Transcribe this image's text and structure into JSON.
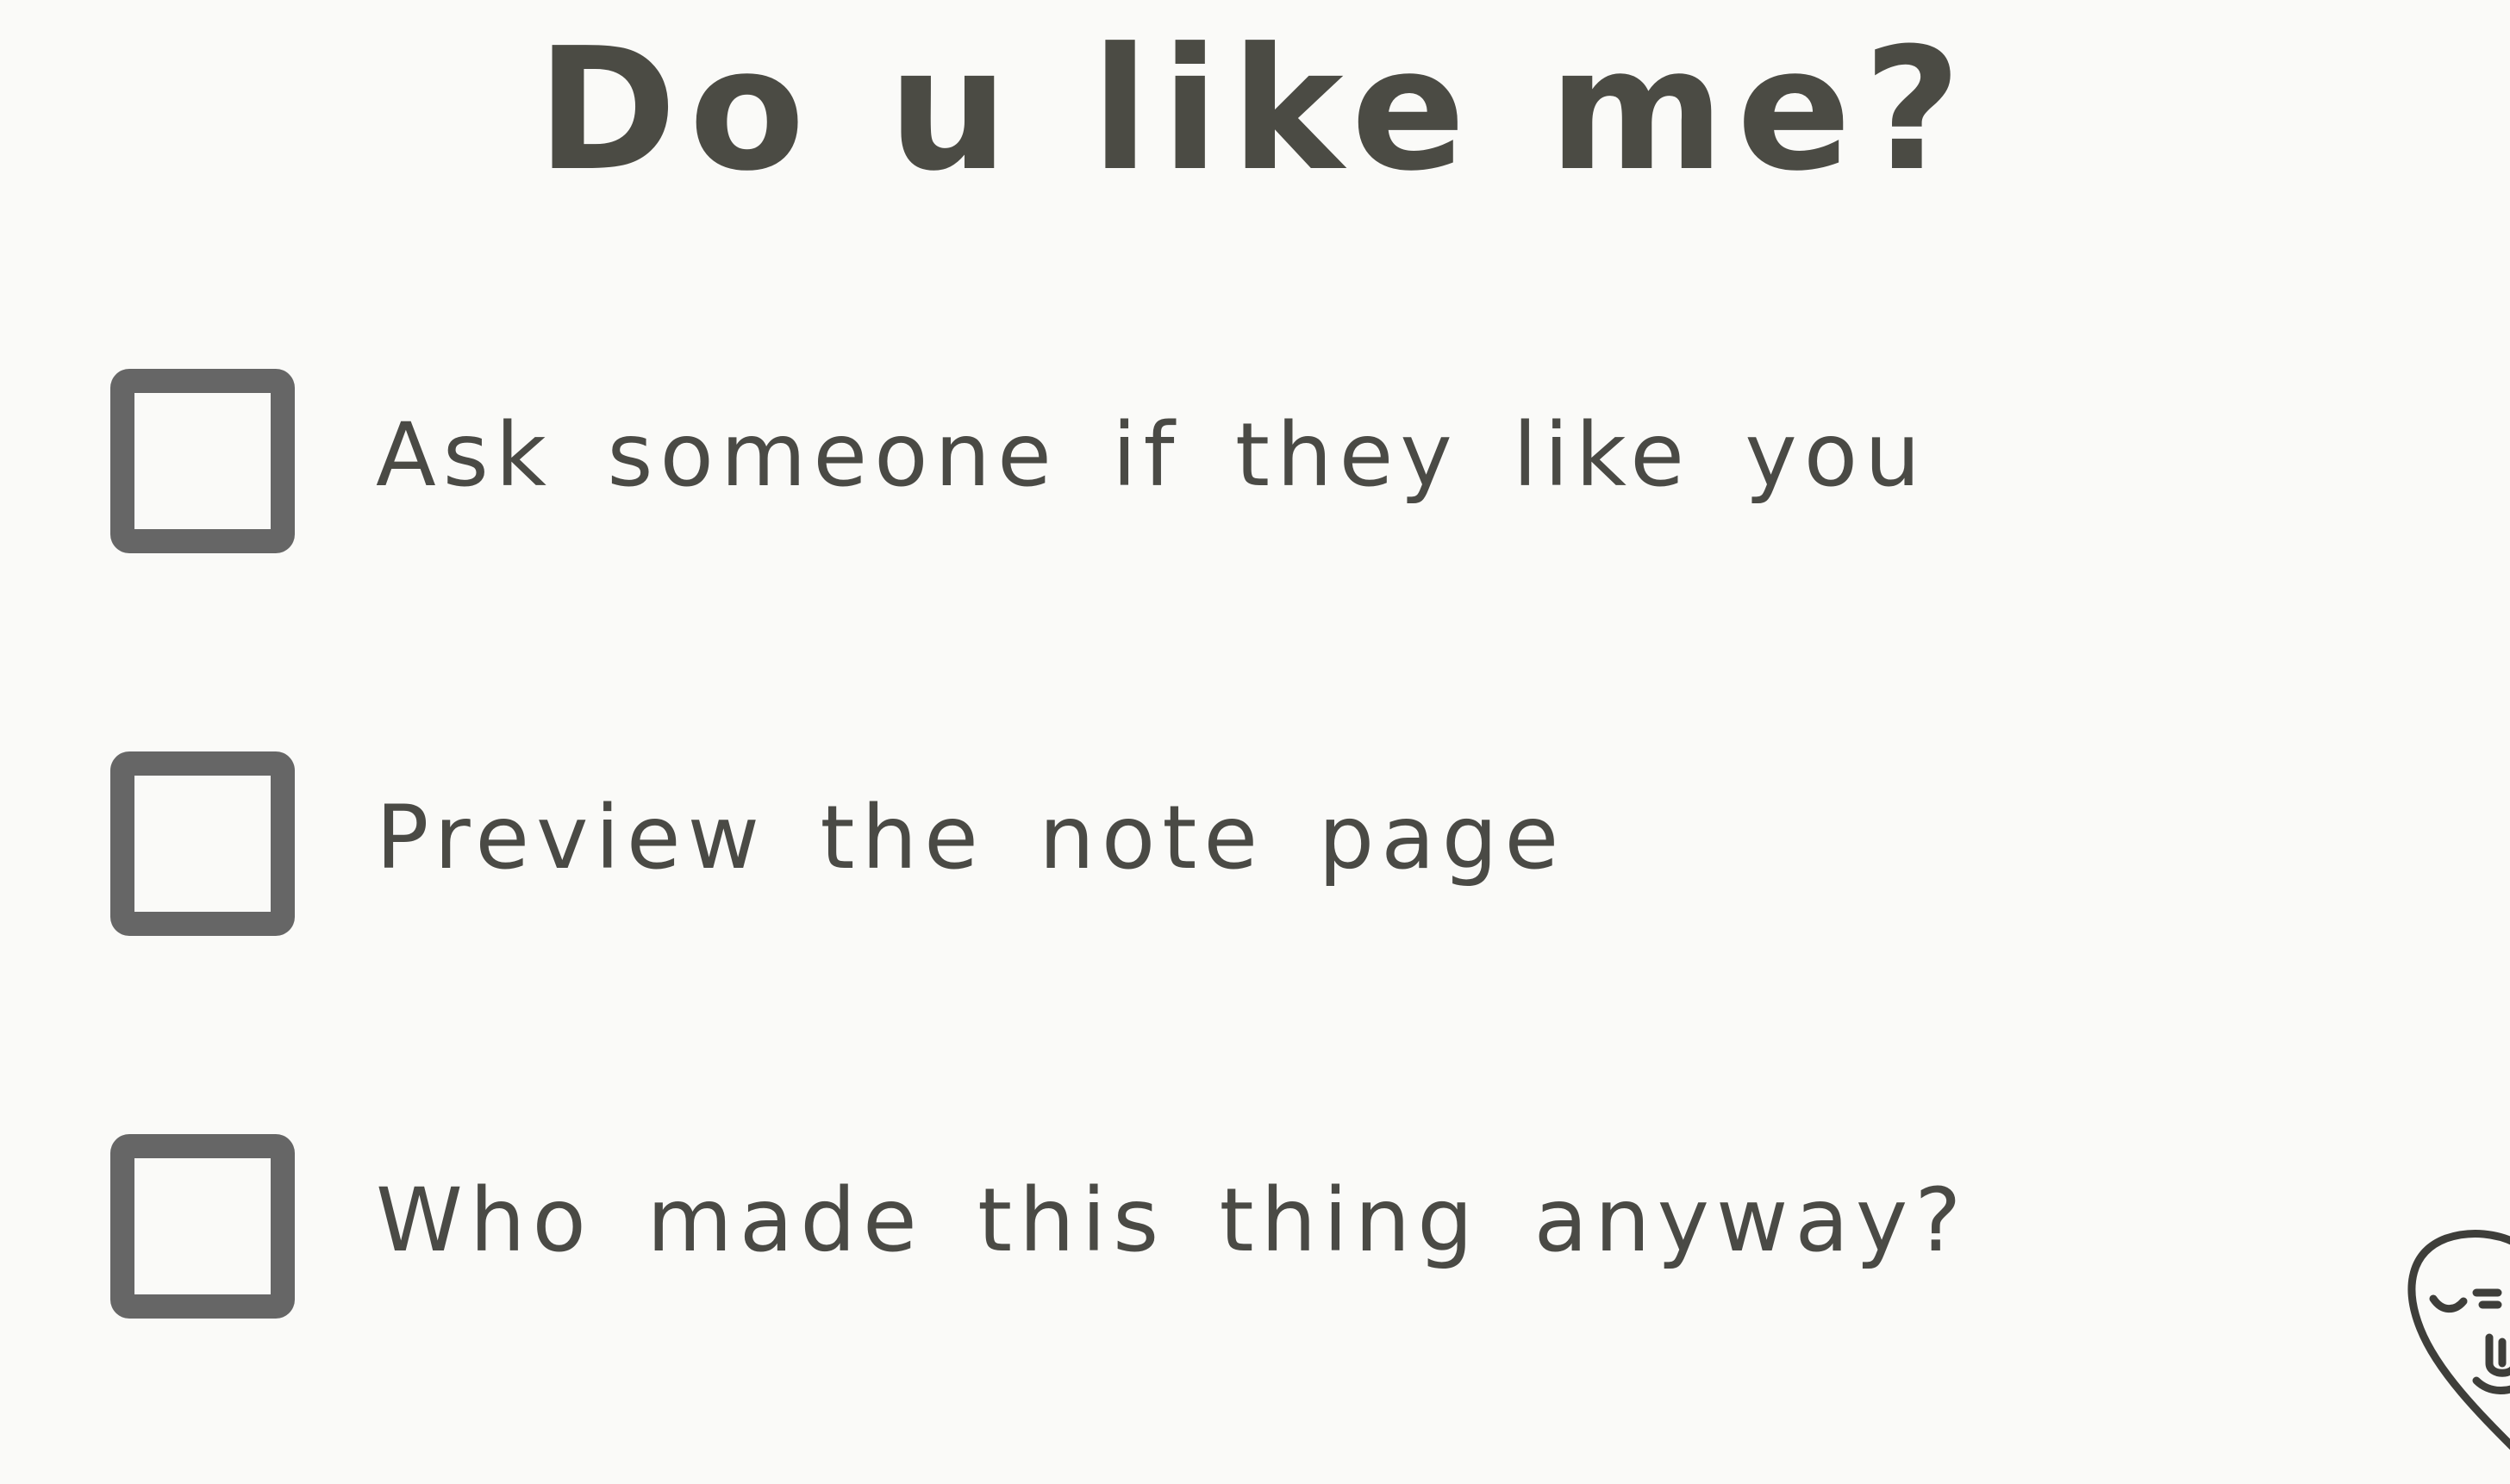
{
  "title": "Do u like me?",
  "checklist": {
    "items": [
      {
        "label": "Ask someone if they like you",
        "checked": false
      },
      {
        "label": "Preview the note page",
        "checked": false
      },
      {
        "label": "Who made this thing anyway?",
        "checked": false
      }
    ]
  },
  "colors": {
    "paper": "#fafaf8",
    "rule_line": "#a3a8e2",
    "ink": "#4b4b44",
    "checkbox_border": "#666666"
  },
  "mascot": {
    "icon": "heart-face-doodle-icon"
  }
}
